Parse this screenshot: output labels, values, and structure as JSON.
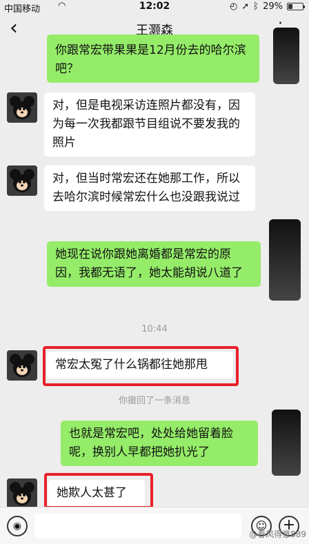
{
  "status": {
    "carrier": "中国移动",
    "time": "12:02",
    "battery": "29%",
    "battery_level": 0.29
  },
  "header": {
    "title": "王灏森"
  },
  "messages": [
    {
      "dir": "out",
      "text": "你跟常宏带果果是12月份去的哈尔滨吧？"
    },
    {
      "dir": "in",
      "text": "对，但是电视采访连照片都没有，因为每一次我都跟节目组说不要发我的照片"
    },
    {
      "dir": "in",
      "text": "对，但当时常宏还在她那工作，所以去哈尔滨时候常宏什么也没跟我说过"
    },
    {
      "dir": "out",
      "text": "她现在说你跟她离婚都是常宏的原因，我都无语了，她太能胡说八道了"
    },
    {
      "dir": "in",
      "text": "常宏太冤了什么锅都往她那甩"
    },
    {
      "dir": "out",
      "text": "也就是常宏吧，处处给她留着脸呢，换别人早都把她扒光了"
    },
    {
      "dir": "in",
      "text": "她欺人太甚了"
    }
  ],
  "time_divider": "10:44",
  "recall_notice": "你撤回了一条消息",
  "watermark": "@春风得意889"
}
